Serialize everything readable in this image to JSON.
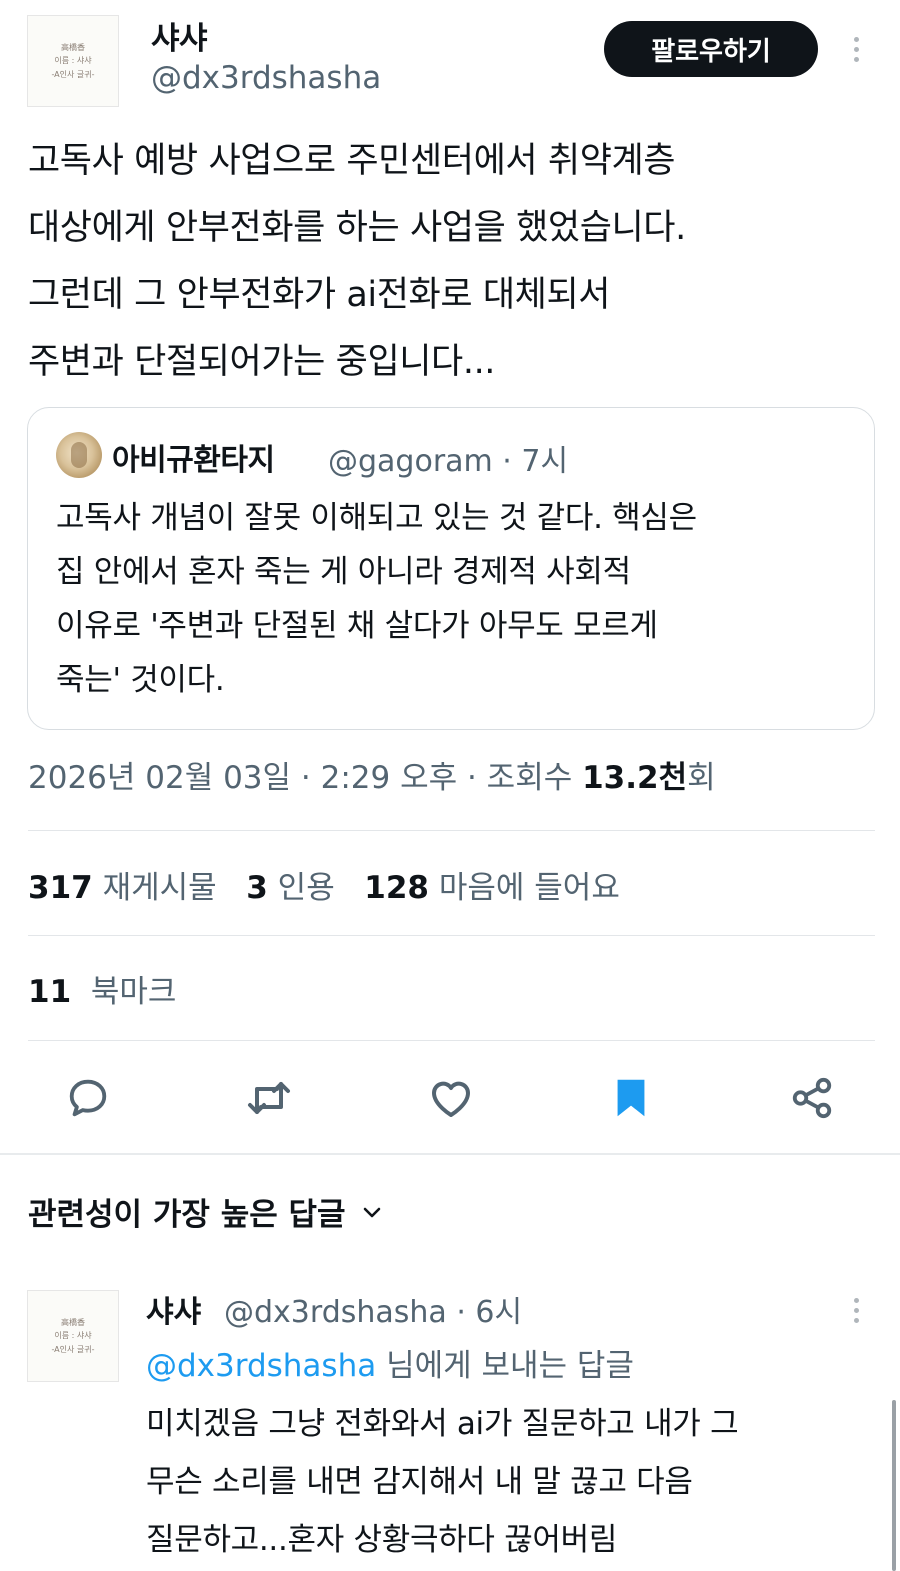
{
  "tweet": {
    "author_name": "샤샤",
    "author_handle": "@dx3rdshasha",
    "avatar_lines": [
      "高橋香",
      "이름 : 샤샤",
      "-A인사 글귀-"
    ],
    "follow_label": "팔로우하기",
    "text_lines": [
      "고독사 예방 사업으로 주민센터에서 취약계층",
      "대상에게 안부전화를 하는 사업을 했었습니다.",
      "그런데 그 안부전화가 ai전화로 대체되서",
      "주변과 단절되어가는 중입니다..."
    ],
    "quoted": {
      "author_name": "아비규환타지",
      "meta": "@gagoram · 7시",
      "text_lines": [
        "고독사 개념이 잘못 이해되고 있는 것 같다. 핵심은",
        "집 안에서 혼자 죽는 게 아니라 경제적 사회적",
        "이유로 '주변과 단절된 채 살다가 아무도 모르게",
        "죽는' 것이다."
      ]
    },
    "timestamp": "2026년 02월 03일 · 2:29 오후 · 조회수 ",
    "views_value": "13.2천",
    "views_suffix": "회",
    "stats": {
      "reposts": "317",
      "reposts_label": "재게시물",
      "quotes": "3",
      "quotes_label": "인용",
      "likes": "128",
      "likes_label": "마음에 들어요",
      "bookmarks": "11",
      "bookmarks_label": "북마크"
    },
    "actions": {
      "reply_icon": "speech-bubble-icon",
      "repost_icon": "repost-arrows-icon",
      "like_icon": "heart-icon",
      "bookmark_icon": "bookmark-filled-icon",
      "share_icon": "share-nodes-icon"
    },
    "accent_color": "#1d9bf0"
  },
  "replies_section": {
    "sort_label": "관련성이 가장 높은 답글"
  },
  "reply": {
    "author_name": "샤샤",
    "meta": "@dx3rdshasha · 6시",
    "replying_to_mention": "@dx3rdshasha",
    "replying_to_suffix": " 님에게 보내는 답글",
    "text_lines": [
      "미치겠음 그냥 전화와서 ai가 질문하고 내가 그",
      "무슨 소리를 내면 감지해서 내 말 끊고 다음",
      "질문하고...혼자 상황극하다 끊어버림"
    ]
  }
}
